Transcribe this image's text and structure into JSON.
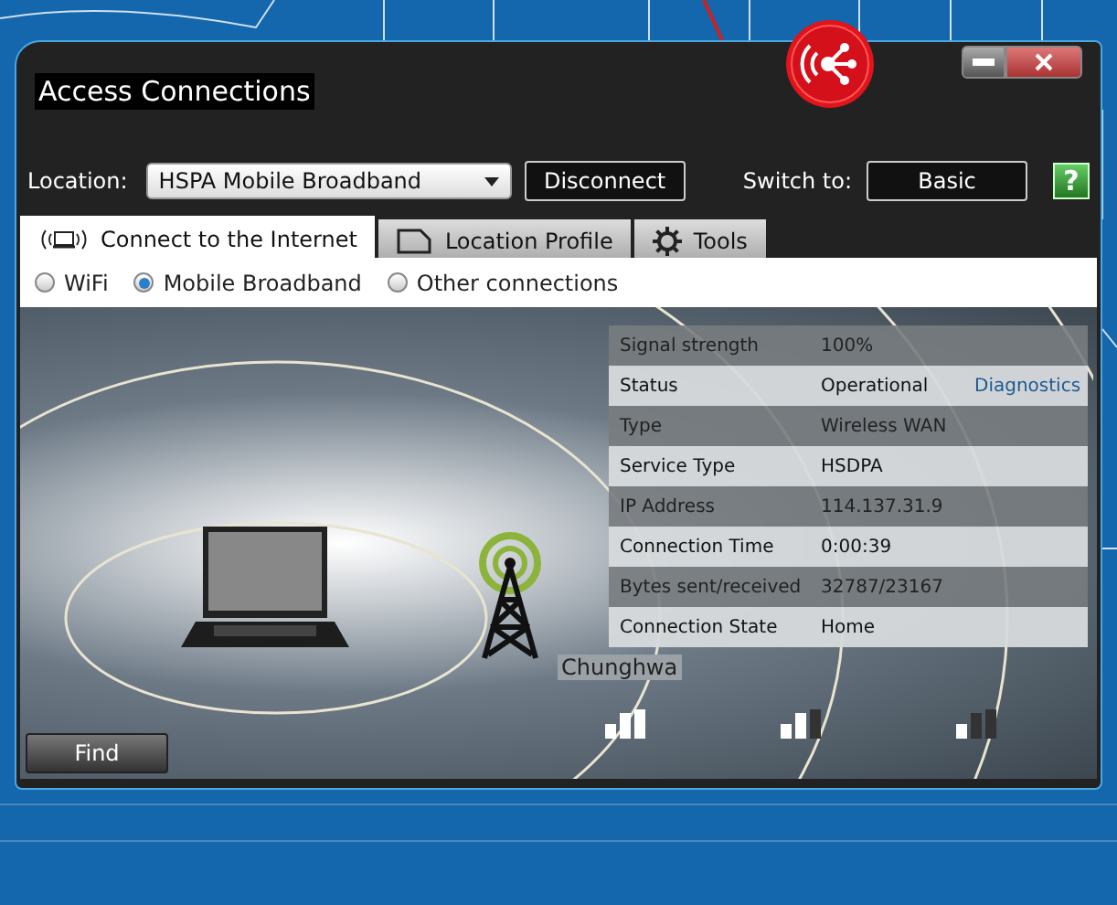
{
  "window": {
    "title": "Access Connections"
  },
  "toolbar": {
    "location_label": "Location:",
    "location_value": "HSPA Mobile Broadband",
    "disconnect": "Disconnect",
    "switch_label": "Switch to:",
    "switch_button": "Basic",
    "help": "?"
  },
  "tabs": [
    {
      "label": "Connect to the Internet",
      "kind": "connect",
      "selected": true
    },
    {
      "label": "Location Profile",
      "kind": "profile",
      "selected": false
    },
    {
      "label": "Tools",
      "kind": "tools",
      "selected": false
    }
  ],
  "connection_types": [
    {
      "label": "WiFi",
      "selected": false
    },
    {
      "label": "Mobile Broadband",
      "selected": true
    },
    {
      "label": "Other connections",
      "selected": false
    }
  ],
  "details": [
    {
      "label": "Signal strength",
      "value": "100%"
    },
    {
      "label": "Status",
      "value": "Operational",
      "link": "Diagnostics"
    },
    {
      "label": "Type",
      "value": "Wireless WAN"
    },
    {
      "label": "Service Type",
      "value": "HSDPA"
    },
    {
      "label": "IP Address",
      "value": "114.137.31.9"
    },
    {
      "label": "Connection Time",
      "value": "0:00:39"
    },
    {
      "label": "Bytes sent/received",
      "value": "32787/23167"
    },
    {
      "label": "Connection State",
      "value": "Home"
    }
  ],
  "network_name": "Chunghwa",
  "find_button": "Find"
}
